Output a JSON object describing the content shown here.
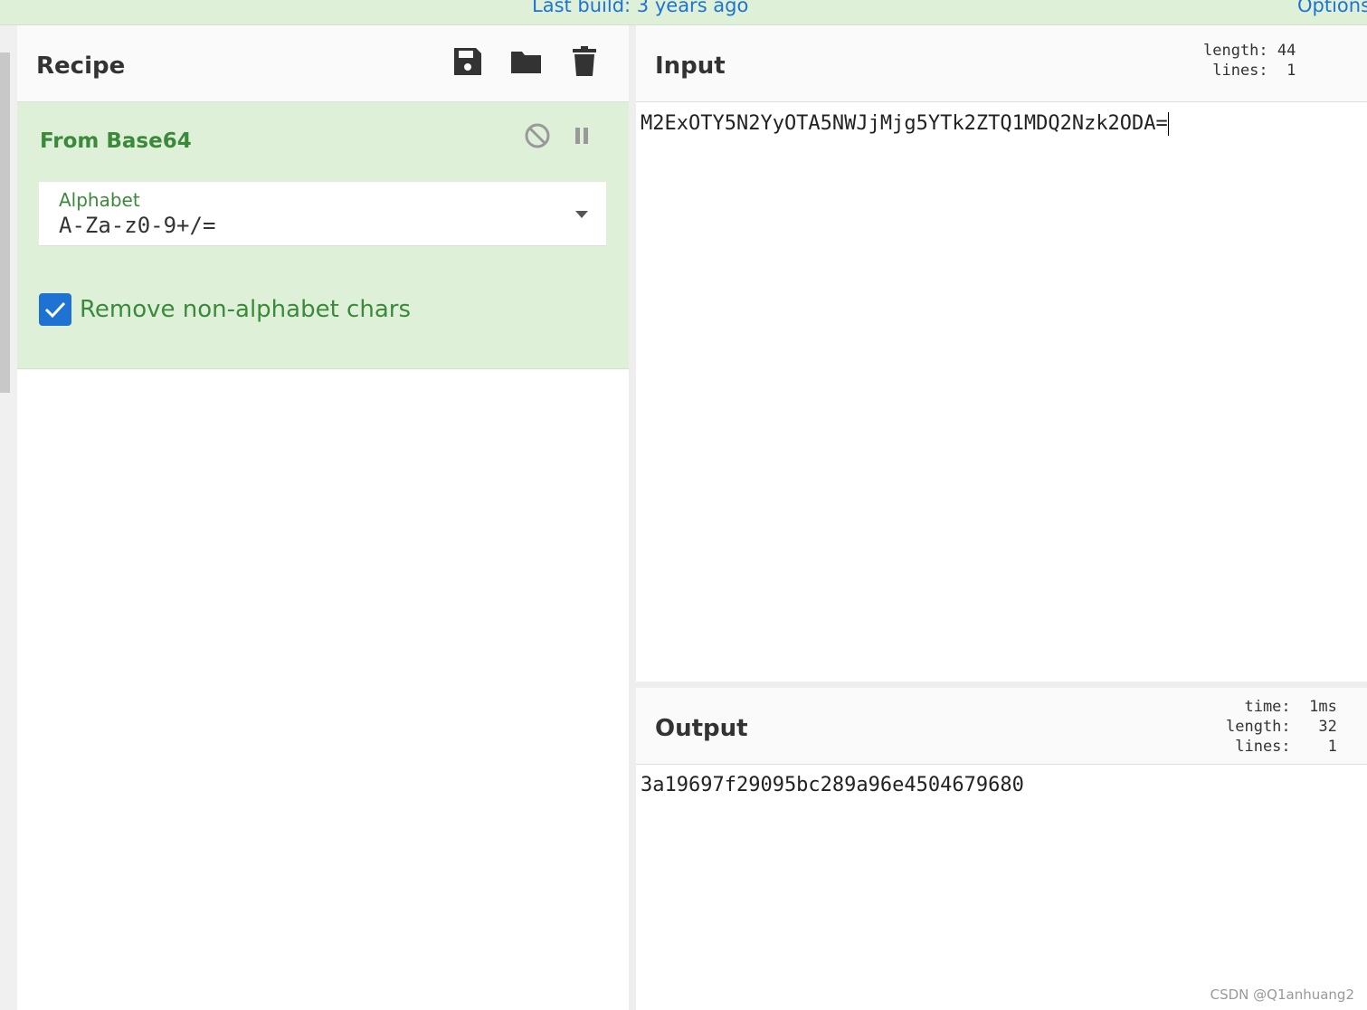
{
  "banner": {
    "build": "Last build: 3 years ago",
    "options": "Options"
  },
  "recipe": {
    "title": "Recipe",
    "icons": [
      "save-icon",
      "folder-open-icon",
      "trash-icon"
    ],
    "operation": {
      "name": "From Base64",
      "alphabet_label": "Alphabet",
      "alphabet_value": "A-Za-z0-9+/=",
      "checkbox_label": "Remove non-alphabet chars",
      "checkbox_checked": true
    }
  },
  "input": {
    "title": "Input",
    "stats": "length: 44\n lines:  1",
    "value": "M2ExOTY5N2YyOTA5NWJjMjg5YTk2ZTQ1MDQ2Nzk2ODA="
  },
  "output": {
    "title": "Output",
    "stats": "  time:  1ms\nlength:   32\n lines:    1",
    "value": "3a19697f29095bc289a96e4504679680"
  },
  "watermark": "CSDN @Q1anhuang2",
  "colors": {
    "accent_green": "#3b8a3b",
    "banner_bg": "#dff0d8",
    "link_blue": "#1e73d2"
  }
}
